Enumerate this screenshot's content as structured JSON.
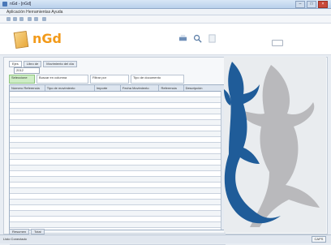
{
  "window": {
    "title": "nGd - [nGd]",
    "minimize": "–",
    "maximize": "□",
    "close": "×"
  },
  "menu": {
    "label": "Aplicación  Herramientas  Ayuda"
  },
  "brand": {
    "name": "nGd"
  },
  "tabs": [
    {
      "label": "Ejes"
    },
    {
      "label": "Libro de"
    },
    {
      "label": "Movimiento del día"
    }
  ],
  "select": {
    "value": "2012"
  },
  "filters": [
    {
      "label": "Seleccione"
    },
    {
      "label": "Buscar en columna"
    },
    {
      "label": "Filtrar por"
    },
    {
      "label": "Tipo de documento"
    }
  ],
  "grid": {
    "columns": [
      "Número Referencia",
      "Tipo de movimiento",
      "Importe",
      "Fecha Movimiento",
      "Referencia",
      "Descripción"
    ],
    "row_count": 27
  },
  "bottom_tabs": [
    {
      "label": "Resumen"
    },
    {
      "label": "Total"
    }
  ],
  "status": {
    "text": "Listo  Conectado",
    "right": "CAPS"
  },
  "colors": {
    "accent": "#f29a1a",
    "lizard_blue": "#1f5c99",
    "lizard_gray": "#b9b9bc"
  }
}
